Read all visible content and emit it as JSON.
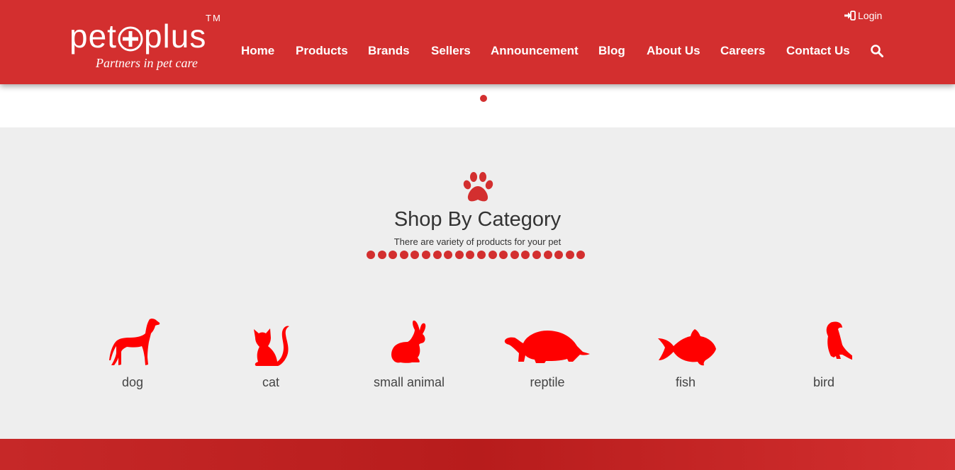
{
  "brand": {
    "name_left": "pet",
    "name_right": "plus",
    "trademark": "TM",
    "tagline": "Partners in pet care"
  },
  "header": {
    "login_label": "Login",
    "nav": [
      {
        "label": "Home"
      },
      {
        "label": "Products"
      },
      {
        "label": "Brands"
      },
      {
        "label": "Sellers"
      },
      {
        "label": "Announcement"
      },
      {
        "label": "Blog"
      },
      {
        "label": "About Us"
      },
      {
        "label": "Careers"
      },
      {
        "label": "Contact Us"
      }
    ],
    "search_icon": "search-icon"
  },
  "colors": {
    "brand_red": "#d32f2f",
    "icon_red": "#ff0000",
    "section_bg": "#eeeeee"
  },
  "category_section": {
    "title": "Shop By Category",
    "subtitle": "There are variety of products for your pet",
    "categories": [
      {
        "label": "dog",
        "icon": "dog-icon"
      },
      {
        "label": "cat",
        "icon": "cat-icon"
      },
      {
        "label": "small animal",
        "icon": "rabbit-icon"
      },
      {
        "label": "reptile",
        "icon": "turtle-icon"
      },
      {
        "label": "fish",
        "icon": "fish-icon"
      },
      {
        "label": "bird",
        "icon": "parrot-icon"
      }
    ]
  }
}
